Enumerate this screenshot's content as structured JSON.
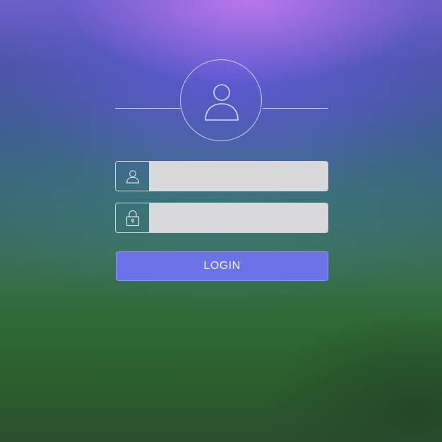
{
  "login_form": {
    "avatar_icon": "user-icon",
    "username": {
      "icon": "user-icon",
      "value": "",
      "placeholder": ""
    },
    "password": {
      "icon": "padlock-icon",
      "value": "",
      "placeholder": ""
    },
    "login_label": "LOGIN"
  },
  "colors": {
    "button": "#6b73e6",
    "field_background": "#d9d9db",
    "outline": "#e1e1f5"
  }
}
